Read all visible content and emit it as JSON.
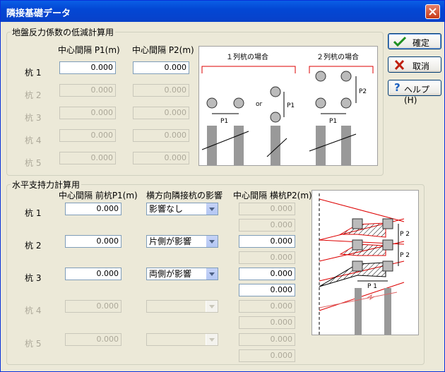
{
  "window": {
    "title": "隣接基礎データ"
  },
  "buttons": {
    "ok": "確定",
    "cancel": "取消",
    "help": "ヘルプ(H)"
  },
  "subgrade": {
    "legend": "地盤反力係数の低減計算用",
    "col1": "中心間隔 P1(m)",
    "col2": "中心間隔 P2(m)",
    "rows": [
      {
        "label": "杭 1",
        "p1": "0.000",
        "p2": "0.000",
        "enabled": true
      },
      {
        "label": "杭 2",
        "p1": "0.000",
        "p2": "0.000",
        "enabled": false
      },
      {
        "label": "杭 3",
        "p1": "0.000",
        "p2": "0.000",
        "enabled": false
      },
      {
        "label": "杭 4",
        "p1": "0.000",
        "p2": "0.000",
        "enabled": false
      },
      {
        "label": "杭 5",
        "p1": "0.000",
        "p2": "0.000",
        "enabled": false
      }
    ],
    "diagram": {
      "case1": "１列杭の場合",
      "case2": "２列杭の場合",
      "or": "or",
      "p1": "P1",
      "p2": "P2"
    }
  },
  "horizontal": {
    "legend": "水平支持力計算用",
    "col1": "中心間隔 前杭P1(m)",
    "col2": "横方向隣接杭の影響",
    "col3": "中心間隔 横杭P2(m)",
    "rows": [
      {
        "label": "杭 1",
        "p1": "0.000",
        "effect": "影響なし",
        "p2a": "0.000",
        "p2b": "0.000",
        "enabled": true
      },
      {
        "label": "杭 2",
        "p1": "0.000",
        "effect": "片側が影響",
        "p2a": "0.000",
        "p2b": "0.000",
        "enabled": true
      },
      {
        "label": "杭 3",
        "p1": "0.000",
        "effect": "両側が影響",
        "p2a": "0.000",
        "p2b": "0.000",
        "enabled": true
      },
      {
        "label": "杭 4",
        "p1": "0.000",
        "effect": "",
        "p2a": "0.000",
        "p2b": "0.000",
        "enabled": false
      },
      {
        "label": "杭 5",
        "p1": "0.000",
        "effect": "",
        "p2a": "0.000",
        "p2b": "0.000",
        "enabled": false
      }
    ],
    "diagram": {
      "p1": "P 1",
      "p2a": "P 2",
      "p2b": "P 2"
    }
  }
}
